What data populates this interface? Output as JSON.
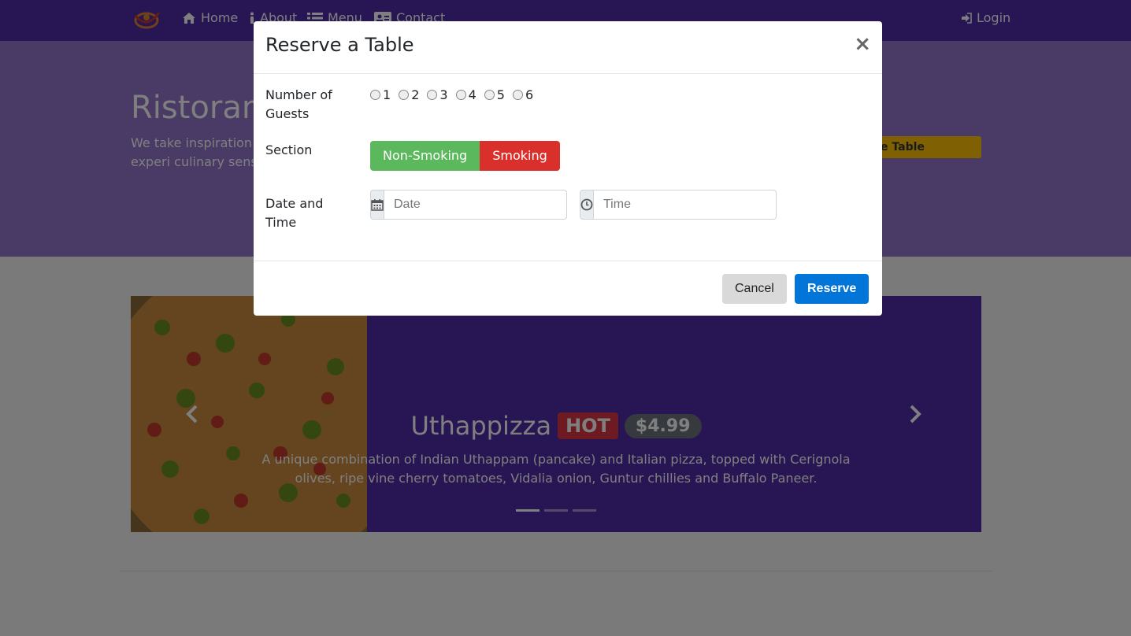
{
  "navbar": {
    "items": [
      {
        "label": "Home",
        "icon": "home-icon"
      },
      {
        "label": "About",
        "icon": "info-icon"
      },
      {
        "label": "Menu",
        "icon": "list-icon"
      },
      {
        "label": "Contact",
        "icon": "address-card-icon"
      }
    ],
    "login_label": "Login"
  },
  "jumbotron": {
    "title": "Ristoran",
    "text": "We take inspiration f unique fusion experi culinary senses!",
    "reserve_button": "e Table"
  },
  "carousel": {
    "title": "Uthappizza",
    "badge": "HOT",
    "price": "$4.99",
    "description": "A unique combination of Indian Uthappam (pancake) and Italian pizza, topped with Cerignola olives, ripe vine cherry tomatoes, Vidalia onion, Guntur chillies and Buffalo Paneer.",
    "active_slide": 1,
    "slide_count": 3
  },
  "modal": {
    "title": "Reserve a Table",
    "close_label": "×",
    "guests_label": "Number of Guests",
    "guest_options": [
      "1",
      "2",
      "3",
      "4",
      "5",
      "6"
    ],
    "section_label": "Section",
    "section_options": [
      "Non-Smoking",
      "Smoking"
    ],
    "datetime_label": "Date and Time",
    "date_placeholder": "Date",
    "time_placeholder": "Time",
    "cancel_label": "Cancel",
    "reserve_label": "Reserve"
  },
  "colors": {
    "navbar": "#512da8",
    "jumbotron": "#9575cd",
    "non_smoking": "#5cb85c",
    "smoking": "#d9302c",
    "reserve": "#0275d8"
  }
}
